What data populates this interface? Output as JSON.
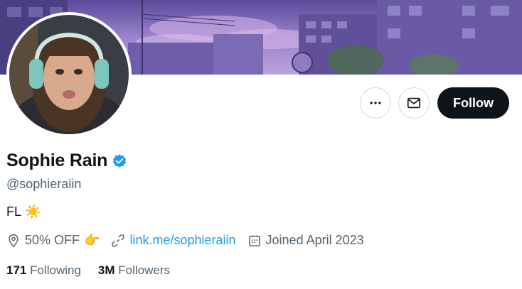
{
  "profile": {
    "name": "Sophie Rain",
    "handle": "@sophieraiin",
    "bio_text": "FL",
    "bio_emoji": "☀️",
    "location": "50% OFF",
    "location_emoji": "👉",
    "link_text": "link.me/sophieraiin",
    "joined": "Joined April 2023",
    "following_count": "171",
    "following_label": "Following",
    "followers_count": "3M",
    "followers_label": "Followers"
  },
  "actions": {
    "follow_label": "Follow",
    "more_icon": "more-horizontal-icon",
    "message_icon": "envelope-icon"
  },
  "colors": {
    "accent": "#1d9bf0",
    "verified": "#1d9bf0",
    "follow_bg": "#0f1419",
    "secondary_text": "#536471"
  }
}
